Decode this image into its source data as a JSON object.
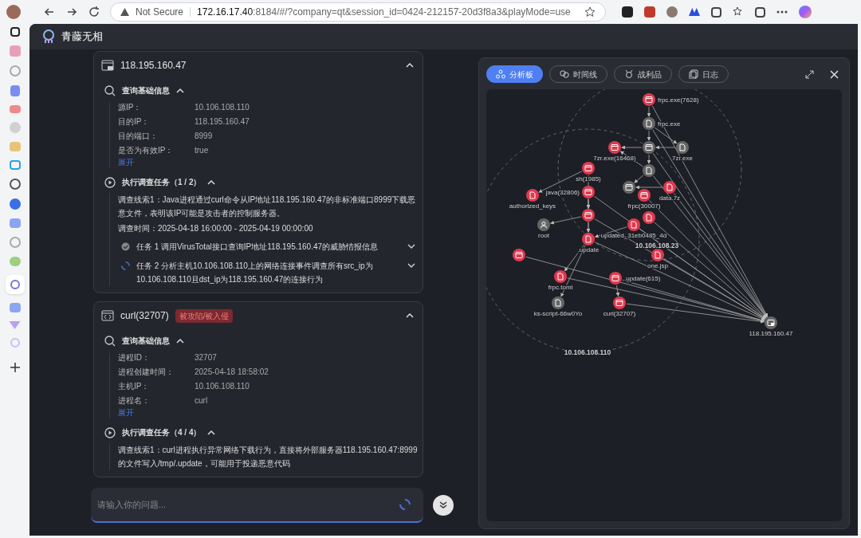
{
  "browser": {
    "security": "Not Secure",
    "url_host": "172.16.17.40",
    "url_rest": ":8184/#/?company=qt&session_id=0424-212157-20d3f8a3&playMode=use"
  },
  "app": {
    "title": "青藤无相"
  },
  "cards": [
    {
      "kind": "ip",
      "title": "118.195.160.47",
      "expanded": true,
      "info_title": "查询基础信息",
      "info": [
        {
          "label": "源IP：",
          "value": "10.106.108.110"
        },
        {
          "label": "目的IP：",
          "value": "118.195.160.47"
        },
        {
          "label": "目的端口：",
          "value": "8999"
        },
        {
          "label": "是否为有效IP：",
          "value": "true"
        }
      ],
      "expand_link": "展开",
      "tasks_title": "执行调查任务（1 / 2）",
      "clue": "调查线索1：Java进程通过curl命令从IP地址118.195.160.47的非标准端口8999下载恶意文件，表明该IP可能是攻击者的控制服务器。",
      "time": "调查时间：2025-04-18 16:00:00 - 2025-04-19 00:00:00",
      "tasks": [
        {
          "done": true,
          "text": "任务 1 调用VirusTotal接口查询IP地址118.195.160.47的威胁情报信息"
        },
        {
          "done": false,
          "text": "任务 2 分析主机10.106.108.110上的网络连接事件调查所有src_ip为10.106.108.110且dst_ip为118.195.160.47的连接行为"
        }
      ]
    },
    {
      "kind": "process",
      "title": "curl(32707)",
      "badge": "被攻陷/被入侵",
      "expanded": true,
      "info_title": "查询基础信息",
      "info": [
        {
          "label": "进程ID：",
          "value": "32707"
        },
        {
          "label": "进程创建时间：",
          "value": "2025-04-18 18:58:02"
        },
        {
          "label": "主机IP：",
          "value": "10.106.108.110"
        },
        {
          "label": "进程名：",
          "value": "curl"
        }
      ],
      "expand_link": "展开",
      "tasks_title": "执行调查任务（4 / 4）",
      "clue": "调查线索1：curl进程执行异常网络下载行为，直接将外部服务器118.195.160.47:8999的文件写入/tmp/.update，可能用于投递恶意代码"
    }
  ],
  "chat": {
    "placeholder": "请输入你的问题..."
  },
  "panel": {
    "tabs": [
      {
        "kind": "graph",
        "label": "分析板",
        "selected": true
      },
      {
        "kind": "timeline",
        "label": "时间线",
        "selected": false
      },
      {
        "kind": "loot",
        "label": "战利品",
        "selected": false
      },
      {
        "kind": "log",
        "label": "日志",
        "selected": false
      }
    ]
  },
  "graph": {
    "zones": [
      {
        "label": "10.106.108.23"
      },
      {
        "label": "10.106.108.110"
      }
    ],
    "nodes": [
      {
        "kind": "process",
        "alert": true,
        "label": "frpc.exe(7628)"
      },
      {
        "kind": "file",
        "alert": false,
        "label": "frpc.exe"
      },
      {
        "kind": "process",
        "alert": false
      },
      {
        "kind": "process",
        "alert": true,
        "label": "7zr.exe(16468)"
      },
      {
        "kind": "file",
        "alert": false,
        "label": "7zr.exe"
      },
      {
        "kind": "file",
        "alert": false
      },
      {
        "kind": "process",
        "alert": true,
        "label": "sh(1985)"
      },
      {
        "kind": "file",
        "alert": true,
        "label": "authorized_keys"
      },
      {
        "kind": "process",
        "alert": true,
        "label": "java(32806)"
      },
      {
        "kind": "process",
        "alert": false
      },
      {
        "kind": "file",
        "alert": true,
        "label": "data.7z"
      },
      {
        "kind": "process",
        "alert": true,
        "label": "frpc(30007)"
      },
      {
        "kind": "process",
        "alert": true
      },
      {
        "kind": "user",
        "alert": false,
        "label": "root"
      },
      {
        "kind": "file",
        "alert": true
      },
      {
        "kind": "file",
        "alert": true,
        "label": "updated_31eb0485_4d"
      },
      {
        "kind": "file",
        "alert": true,
        "label": ".update"
      },
      {
        "kind": "file",
        "alert": true,
        "label": "one.jsp"
      },
      {
        "kind": "process",
        "alert": true
      },
      {
        "kind": "file",
        "alert": true,
        "label": "frpc.toml"
      },
      {
        "kind": "process",
        "alert": true,
        "label": ".update(615)"
      },
      {
        "kind": "file",
        "alert": false,
        "label": "ks-script-66w0Yo"
      },
      {
        "kind": "process",
        "alert": true,
        "label": "curl(32707)"
      },
      {
        "kind": "host",
        "alert": false,
        "label": "118.195.160.47"
      }
    ]
  }
}
